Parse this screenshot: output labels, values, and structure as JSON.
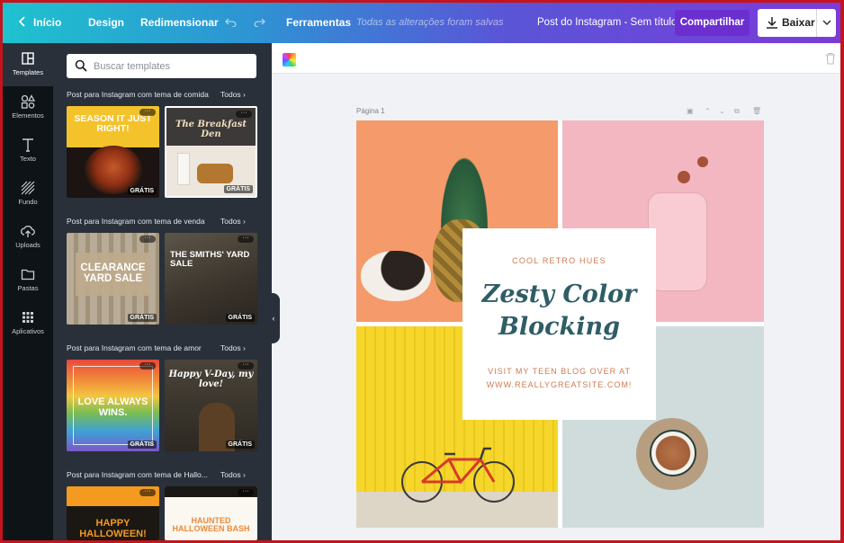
{
  "topbar": {
    "back_label": "Início",
    "design_label": "Design",
    "resize_label": "Redimensionar",
    "tools_label": "Ferramentas",
    "saved_status": "Todas as alterações foram salvas",
    "doc_title": "Post do Instagram - Sem título",
    "share_label": "Compartilhar",
    "download_label": "Baixar"
  },
  "rail": {
    "items": [
      {
        "label": "Templates",
        "icon": "templates-icon"
      },
      {
        "label": "Elementos",
        "icon": "elements-icon"
      },
      {
        "label": "Texto",
        "icon": "text-icon"
      },
      {
        "label": "Fundo",
        "icon": "background-icon"
      },
      {
        "label": "Uploads",
        "icon": "upload-icon"
      },
      {
        "label": "Pastas",
        "icon": "folder-icon"
      },
      {
        "label": "Aplicativos",
        "icon": "apps-icon"
      }
    ]
  },
  "panel": {
    "search_placeholder": "Buscar templates",
    "sections": [
      {
        "title": "Post para Instagram com tema de comida",
        "all": "Todos",
        "thumbs": [
          {
            "text": "SEASON IT JUST RIGHT!",
            "badge": "GRÁTIS"
          },
          {
            "text": "The Breakfast Den",
            "badge": "GRÁTIS"
          }
        ]
      },
      {
        "title": "Post para Instagram com tema de venda",
        "all": "Todos",
        "thumbs": [
          {
            "text": "CLEARANCE YARD SALE",
            "badge": "GRÁTIS"
          },
          {
            "text": "THE SMITHS' YARD SALE",
            "badge": "GRÁTIS"
          }
        ]
      },
      {
        "title": "Post para Instagram com tema de amor",
        "all": "Todos",
        "thumbs": [
          {
            "text": "LOVE ALWAYS WINS.",
            "badge": "GRÁTIS"
          },
          {
            "text": "Happy V-Day, my love!",
            "badge": "GRÁTIS"
          }
        ]
      },
      {
        "title": "Post para Instagram com tema de Hallo...",
        "all": "Todos",
        "thumbs": [
          {
            "text": "HAPPY HALLOWEEN!",
            "badge": ""
          },
          {
            "text": "HAUNTED HALLOWEEN BASH",
            "badge": ""
          }
        ]
      }
    ]
  },
  "canvas": {
    "page_label": "Página 1",
    "design": {
      "top_text": "COOL RETRO HUES",
      "script_line1": "Zesty Color",
      "script_line2": "Blocking",
      "bottom_line1": "VISIT MY TEEN BLOG OVER AT",
      "bottom_line2": "WWW.REALLYGREATSITE.COM!"
    }
  },
  "colors": {
    "accent_share": "#6b2fd0",
    "panel_bg": "#293039",
    "rail_bg": "#0e1318",
    "script_color": "#2f5d66",
    "coral_text": "#d07a52"
  }
}
